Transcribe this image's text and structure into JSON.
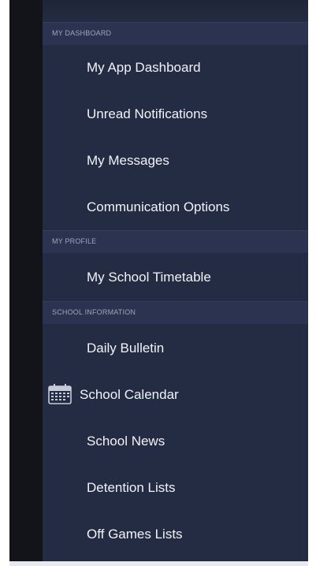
{
  "drawer": {
    "sections": [
      {
        "title": "MY DASHBOARD",
        "items": [
          {
            "label": "My App Dashboard"
          },
          {
            "label": "Unread Notifications"
          },
          {
            "label": "My Messages"
          },
          {
            "label": "Communication Options"
          }
        ]
      },
      {
        "title": "MY PROFILE",
        "items": [
          {
            "label": "My School Timetable"
          }
        ]
      },
      {
        "title": "SCHOOL INFORMATION",
        "items": [
          {
            "label": "Daily Bulletin"
          },
          {
            "label": "School Calendar",
            "icon": "calendar-icon"
          },
          {
            "label": "School News"
          },
          {
            "label": "Detention Lists"
          },
          {
            "label": "Off Games Lists"
          }
        ]
      }
    ]
  }
}
